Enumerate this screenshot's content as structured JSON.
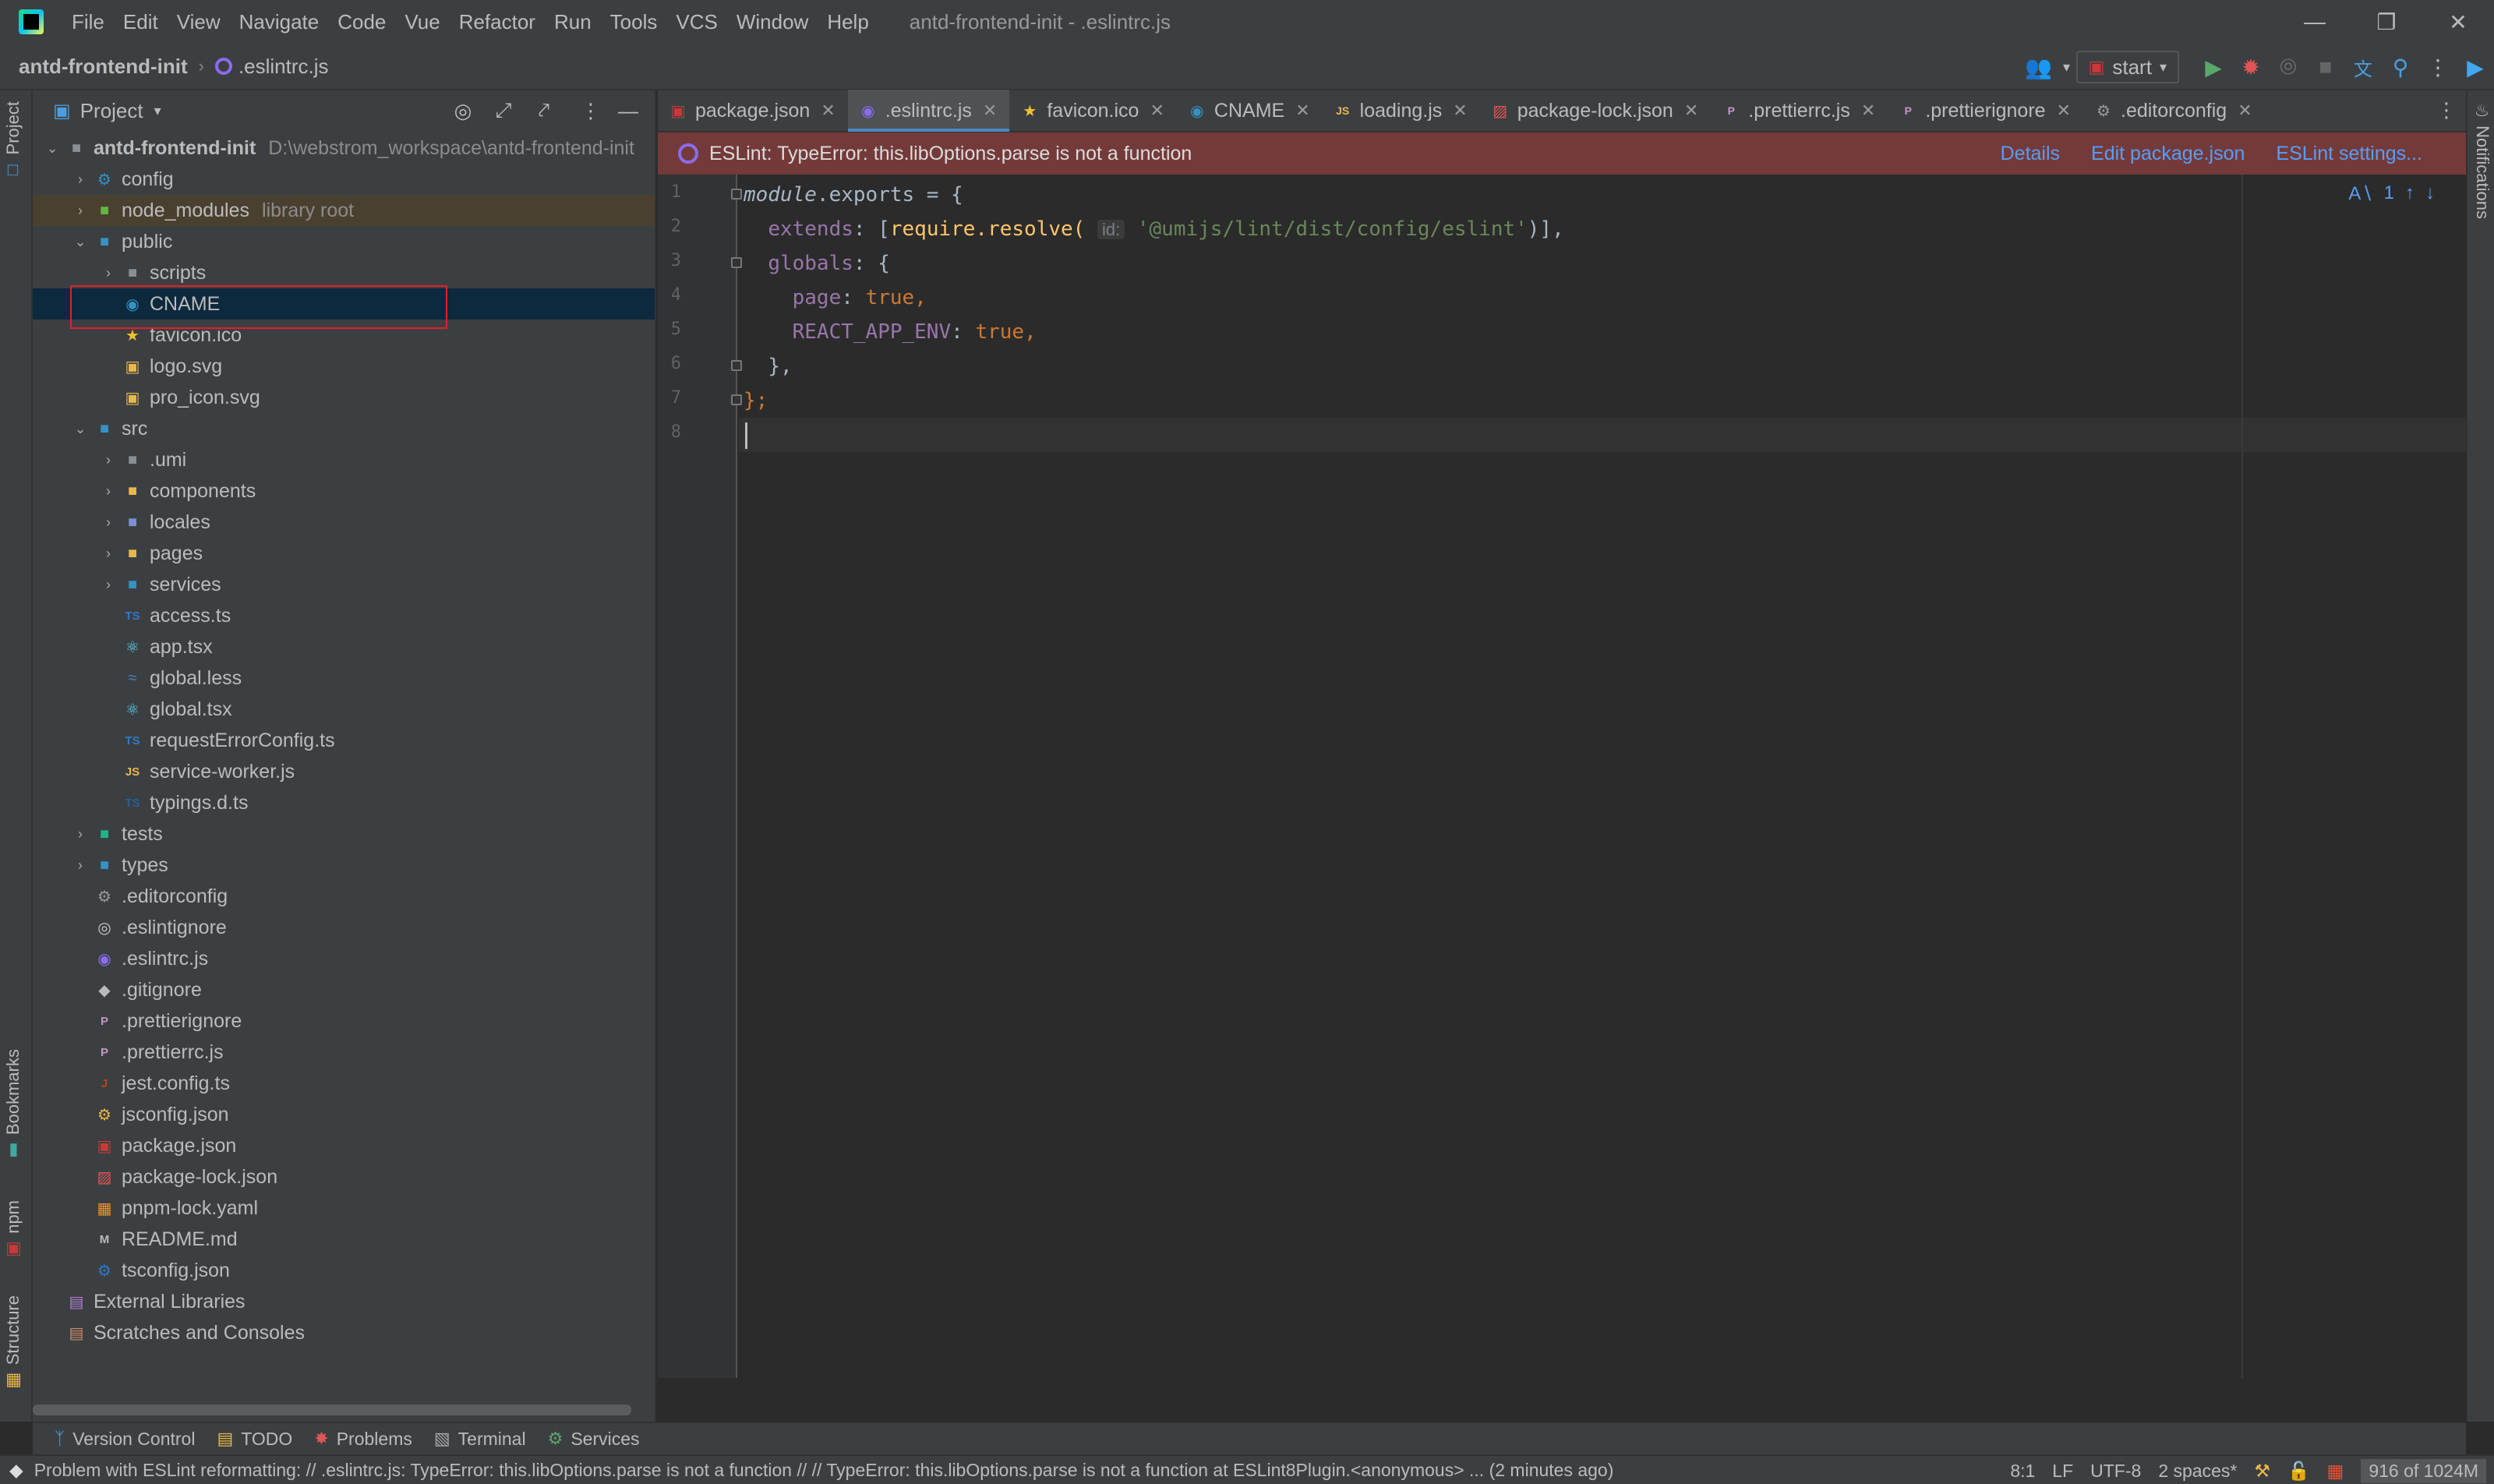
{
  "window": {
    "title": "antd-frontend-init - .eslintrc.js",
    "menu": [
      "File",
      "Edit",
      "View",
      "Navigate",
      "Code",
      "Vue",
      "Refactor",
      "Run",
      "Tools",
      "VCS",
      "Window",
      "Help"
    ]
  },
  "navbar": {
    "project": "antd-frontend-init",
    "file": ".eslintrc.js",
    "run_config": "start"
  },
  "project_panel": {
    "title": "Project",
    "tree": [
      {
        "label": "antd-frontend-init",
        "hint": "D:\\webstrom_workspace\\antd-frontend-init",
        "depth": 0,
        "arrow": "down",
        "icon": "folder-icon",
        "bold": true
      },
      {
        "label": "config",
        "depth": 1,
        "arrow": "right",
        "icon": "config-folder-icon"
      },
      {
        "label": "node_modules",
        "hint": "library root",
        "depth": 1,
        "arrow": "right",
        "icon": "library-folder-icon",
        "lib": true
      },
      {
        "label": "public",
        "depth": 1,
        "arrow": "down",
        "icon": "resource-folder-icon"
      },
      {
        "label": "scripts",
        "depth": 2,
        "arrow": "right",
        "icon": "scripts-folder-icon"
      },
      {
        "label": "CNAME",
        "depth": 2,
        "icon": "globe-icon",
        "selected": true
      },
      {
        "label": "favicon.ico",
        "depth": 2,
        "icon": "star-icon"
      },
      {
        "label": "logo.svg",
        "depth": 2,
        "icon": "image-icon"
      },
      {
        "label": "pro_icon.svg",
        "depth": 2,
        "icon": "image-icon"
      },
      {
        "label": "src",
        "depth": 1,
        "arrow": "down",
        "icon": "source-folder-icon"
      },
      {
        "label": ".umi",
        "depth": 2,
        "arrow": "right",
        "icon": "folder-icon"
      },
      {
        "label": "components",
        "depth": 2,
        "arrow": "right",
        "icon": "components-folder-icon"
      },
      {
        "label": "locales",
        "depth": 2,
        "arrow": "right",
        "icon": "locales-folder-icon"
      },
      {
        "label": "pages",
        "depth": 2,
        "arrow": "right",
        "icon": "pages-folder-icon"
      },
      {
        "label": "services",
        "depth": 2,
        "arrow": "right",
        "icon": "services-folder-icon"
      },
      {
        "label": "access.ts",
        "depth": 2,
        "icon": "typescript-icon"
      },
      {
        "label": "app.tsx",
        "depth": 2,
        "icon": "react-icon"
      },
      {
        "label": "global.less",
        "depth": 2,
        "icon": "less-icon"
      },
      {
        "label": "global.tsx",
        "depth": 2,
        "icon": "react-icon"
      },
      {
        "label": "requestErrorConfig.ts",
        "depth": 2,
        "icon": "typescript-icon"
      },
      {
        "label": "service-worker.js",
        "depth": 2,
        "icon": "javascript-icon"
      },
      {
        "label": "typings.d.ts",
        "depth": 2,
        "icon": "typescript-def-icon"
      },
      {
        "label": "tests",
        "depth": 1,
        "arrow": "right",
        "icon": "test-folder-icon"
      },
      {
        "label": "types",
        "depth": 1,
        "arrow": "right",
        "icon": "types-folder-icon"
      },
      {
        "label": ".editorconfig",
        "depth": 1,
        "icon": "editorconfig-icon"
      },
      {
        "label": ".eslintignore",
        "depth": 1,
        "icon": "ignore-icon"
      },
      {
        "label": ".eslintrc.js",
        "depth": 1,
        "icon": "eslint-icon"
      },
      {
        "label": ".gitignore",
        "depth": 1,
        "icon": "git-icon"
      },
      {
        "label": ".prettierignore",
        "depth": 1,
        "icon": "prettier-icon"
      },
      {
        "label": ".prettierrc.js",
        "depth": 1,
        "icon": "prettier-icon"
      },
      {
        "label": "jest.config.ts",
        "depth": 1,
        "icon": "jest-icon"
      },
      {
        "label": "jsconfig.json",
        "depth": 1,
        "icon": "json-config-icon"
      },
      {
        "label": "package.json",
        "depth": 1,
        "icon": "npm-icon"
      },
      {
        "label": "package-lock.json",
        "depth": 1,
        "icon": "lock-icon"
      },
      {
        "label": "pnpm-lock.yaml",
        "depth": 1,
        "icon": "pnpm-icon"
      },
      {
        "label": "README.md",
        "depth": 1,
        "icon": "markdown-icon"
      },
      {
        "label": "tsconfig.json",
        "depth": 1,
        "icon": "tsconfig-icon"
      },
      {
        "label": "External Libraries",
        "depth": 0,
        "icon": "libraries-icon"
      },
      {
        "label": "Scratches and Consoles",
        "depth": 0,
        "icon": "scratches-icon"
      }
    ]
  },
  "tabs": [
    {
      "label": "package.json",
      "icon": "npm-icon"
    },
    {
      "label": ".eslintrc.js",
      "icon": "eslint-icon",
      "active": true
    },
    {
      "label": "favicon.ico",
      "icon": "star-icon"
    },
    {
      "label": "CNAME",
      "icon": "globe-icon"
    },
    {
      "label": "loading.js",
      "icon": "javascript-icon"
    },
    {
      "label": "package-lock.json",
      "icon": "lock-icon"
    },
    {
      "label": ".prettierrc.js",
      "icon": "prettier-icon"
    },
    {
      "label": ".prettierignore",
      "icon": "prettier-icon"
    },
    {
      "label": ".editorconfig",
      "icon": "editorconfig-icon"
    }
  ],
  "banner": {
    "message": "ESLint: TypeError: this.libOptions.parse is not a function",
    "links": [
      "Details",
      "Edit package.json",
      "ESLint settings..."
    ]
  },
  "editor": {
    "line_numbers": [
      "1",
      "2",
      "3",
      "4",
      "5",
      "6",
      "7",
      "8"
    ],
    "inspection_count": "1",
    "code": {
      "l1_obj": "module",
      "l1_rest": ".exports = {",
      "l2_prop": "extends",
      "l2_a": ": [",
      "l2_fn": "require.resolve(",
      "l2_hint": "id:",
      "l2_str": "'@umijs/lint/dist/config/eslint'",
      "l2_end": ")],",
      "l3_prop": "globals",
      "l3_rest": ": {",
      "l4_prop": "page",
      "l4_kw": "true",
      "l5_prop": "REACT_APP_ENV",
      "l5_kw": "true",
      "l6": "},",
      "l7": "};"
    }
  },
  "left_stripe": [
    "Project",
    "Bookmarks",
    "npm",
    "Structure"
  ],
  "right_stripe": [
    "Notifications"
  ],
  "bottom_tools": [
    "Version Control",
    "TODO",
    "Problems",
    "Terminal",
    "Services"
  ],
  "status": {
    "message": "Problem with ESLint reformatting: // .eslintrc.js: TypeError: this.libOptions.parse is not a function // // TypeError: this.libOptions.parse is not a function     at ESLint8Plugin.<anonymous> ... (2 minutes ago)",
    "position": "8:1",
    "line_sep": "LF",
    "encoding": "UTF-8",
    "indent": "2 spaces*",
    "memory": "916 of 1024M"
  }
}
